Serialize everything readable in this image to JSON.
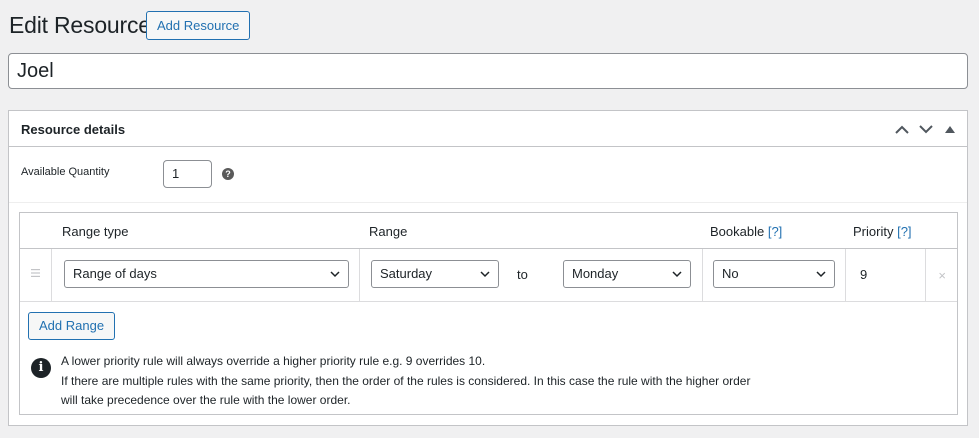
{
  "page": {
    "title": "Edit Resource",
    "add_resource_label": "Add Resource",
    "resource_name": "Joel"
  },
  "panel": {
    "title": "Resource details",
    "quantity_label": "Available Quantity",
    "quantity_value": "1",
    "help_glyph": "?"
  },
  "rules_table": {
    "headers": {
      "range_type": "Range type",
      "range": "Range",
      "bookable": "Bookable",
      "bookable_hint": "[?]",
      "priority": "Priority",
      "priority_hint": "[?]"
    },
    "row": {
      "range_type": "Range of days",
      "range_from": "Saturday",
      "to_label": "to",
      "range_to": "Monday",
      "bookable": "No",
      "priority": "9",
      "remove_glyph": "×"
    },
    "add_range_label": "Add Range",
    "notes": [
      "A lower priority rule will always override a higher priority rule e.g. 9 overrides 10.",
      "If there are multiple rules with the same priority, then the order of the rules is considered. In this case the rule with the higher order",
      "will take precedence over the rule with the lower order."
    ]
  },
  "icons": {
    "collapse_up": "chevron-up-icon",
    "collapse_down": "chevron-down-icon",
    "toggle": "triangle-up-icon",
    "sort": "drag-handle-icon",
    "info": "info-icon"
  },
  "colors": {
    "accent": "#2271b1",
    "text": "#1d2327",
    "border": "#c3c4c7",
    "background": "#f0f0f1"
  }
}
